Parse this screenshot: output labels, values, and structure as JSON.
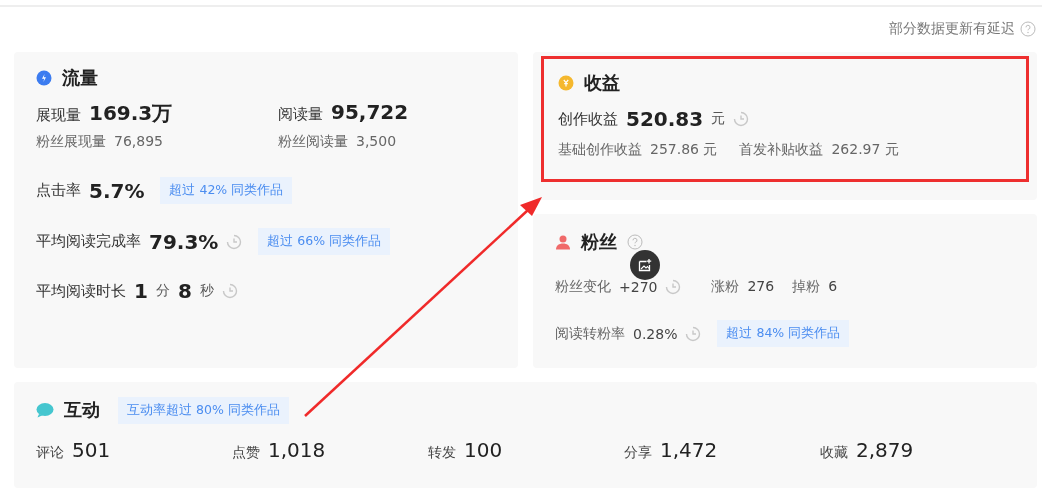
{
  "notice": {
    "text": "部分数据更新有延迟"
  },
  "traffic": {
    "title": "流量",
    "main": [
      {
        "label": "展现量",
        "value": "169.3万"
      },
      {
        "label": "阅读量",
        "value": "95,722"
      }
    ],
    "sub": [
      {
        "label": "粉丝展现量",
        "value": "76,895"
      },
      {
        "label": "粉丝阅读量",
        "value": "3,500"
      }
    ],
    "rows": [
      {
        "label": "点击率",
        "parts": [
          {
            "text": "5.7%",
            "kind": "num"
          }
        ],
        "delayed": false,
        "badge": "超过 42% 同类作品"
      },
      {
        "label": "平均阅读完成率",
        "parts": [
          {
            "text": "79.3%",
            "kind": "num"
          }
        ],
        "delayed": true,
        "badge": "超过 66% 同类作品"
      },
      {
        "label": "平均阅读时长",
        "parts": [
          {
            "text": "1",
            "kind": "num"
          },
          {
            "text": "分",
            "kind": "unit"
          },
          {
            "text": "8",
            "kind": "num"
          },
          {
            "text": "秒",
            "kind": "unit"
          }
        ],
        "delayed": true
      }
    ]
  },
  "income": {
    "title": "收益",
    "highlighted": true,
    "label": "创作收益",
    "value": "520.83",
    "unit": "元",
    "delayed": true,
    "sub": [
      {
        "label": "基础创作收益",
        "value": "257.86 元"
      },
      {
        "label": "首发补贴收益",
        "value": "262.97 元"
      }
    ]
  },
  "fans": {
    "title": "粉丝",
    "change": {
      "label": "粉丝变化",
      "value": "+270",
      "delayed": true
    },
    "stats": [
      {
        "label": "涨粉",
        "value": "276"
      },
      {
        "label": "掉粉",
        "value": "6"
      }
    ],
    "rate": {
      "label": "阅读转粉率",
      "value": "0.28%",
      "delayed": true,
      "badge": "超过 84% 同类作品"
    }
  },
  "interaction": {
    "title": "互动",
    "badge": "互动率超过 80% 同类作品",
    "stats": [
      {
        "label": "评论",
        "value": "501"
      },
      {
        "label": "点赞",
        "value": "1,018"
      },
      {
        "label": "转发",
        "value": "100"
      },
      {
        "label": "分享",
        "value": "1,472"
      },
      {
        "label": "收藏",
        "value": "2,879"
      }
    ]
  }
}
